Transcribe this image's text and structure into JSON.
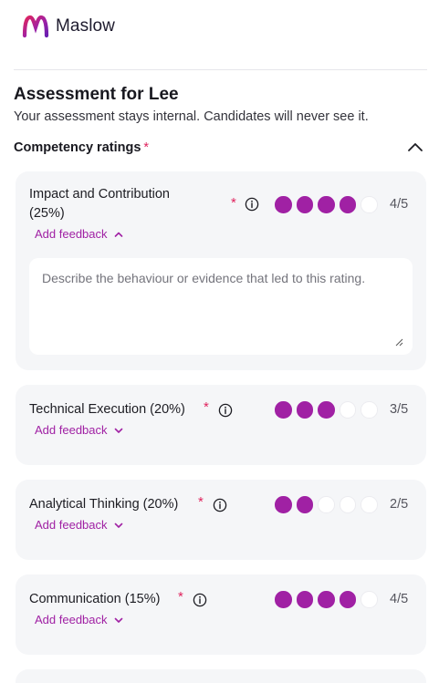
{
  "app": {
    "brand_name": "Maslow",
    "brand_color": "#a021a4",
    "required_color": "#e0245e"
  },
  "page": {
    "title": "Assessment for Lee",
    "subtitle": "Your assessment stays internal. Candidates will never see it."
  },
  "section": {
    "title": "Competency ratings",
    "required_mark": "*",
    "collapse_icon": "chevron-up-icon"
  },
  "competencies": [
    {
      "label": "Impact and Contribution (25%)",
      "rating": 4,
      "max": 5,
      "score_text": "4/5",
      "feedback_label": "Add feedback",
      "feedback_open": true,
      "feedback_placeholder": "Describe the behaviour or evidence that led to this rating.",
      "feedback_value": ""
    },
    {
      "label": "Technical Execution (20%)",
      "rating": 3,
      "max": 5,
      "score_text": "3/5",
      "feedback_label": "Add feedback",
      "feedback_open": false
    },
    {
      "label": "Analytical Thinking (20%)",
      "rating": 2,
      "max": 5,
      "score_text": "2/5",
      "feedback_label": "Add feedback",
      "feedback_open": false
    },
    {
      "label": "Communication (15%)",
      "rating": 4,
      "max": 5,
      "score_text": "4/5",
      "feedback_label": "Add feedback",
      "feedback_open": false
    }
  ]
}
